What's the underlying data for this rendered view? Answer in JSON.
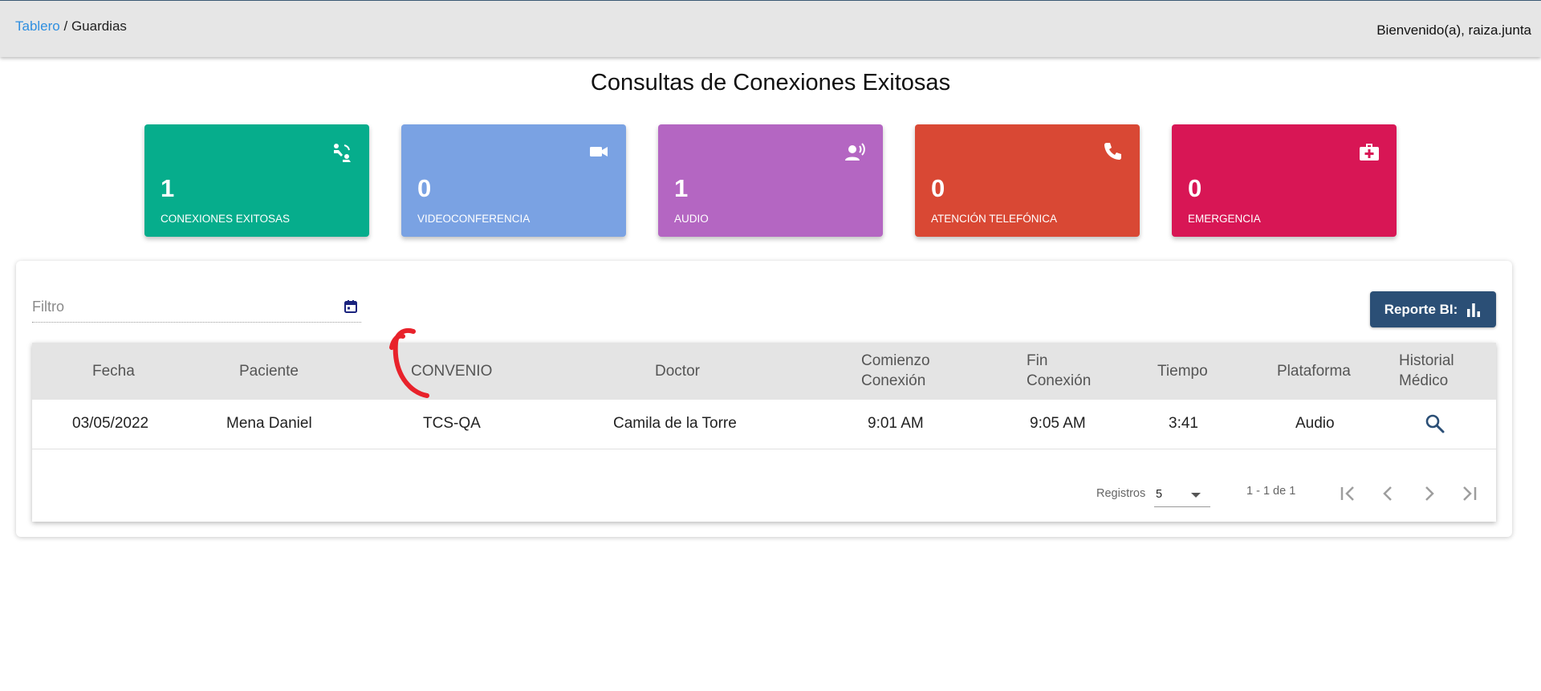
{
  "header": {
    "breadcrumb_link": "Tablero",
    "breadcrumb_sep": " / ",
    "breadcrumb_current": "Guardias",
    "welcome": "Bienvenido(a), raiza.junta"
  },
  "page_title": "Consultas de Conexiones Exitosas",
  "cards": [
    {
      "count": "1",
      "label": "CONEXIONES EXITOSAS",
      "color": "#06ad8c",
      "icon": "connection-icon"
    },
    {
      "count": "0",
      "label": "VIDEOCONFERENCIA",
      "color": "#7aa2e3",
      "icon": "videocam-icon"
    },
    {
      "count": "1",
      "label": "AUDIO",
      "color": "#b466c2",
      "icon": "record-voice-icon"
    },
    {
      "count": "0",
      "label": "ATENCIÓN TELEFÓNICA",
      "color": "#d94834",
      "icon": "phone-icon"
    },
    {
      "count": "0",
      "label": "EMERGENCIA",
      "color": "#d81655",
      "icon": "medical-kit-icon"
    }
  ],
  "filter": {
    "placeholder": "Filtro"
  },
  "report_button": {
    "label": "Reporte BI:"
  },
  "table": {
    "headers": [
      "Fecha",
      "Paciente",
      "CONVENIO",
      "Doctor",
      "Comienzo\nConexión",
      "Fin\nConexión",
      "Tiempo",
      "Plataforma",
      "Historial\nMédico"
    ],
    "headers_split": {
      "comienzo_1": "Comienzo",
      "comienzo_2": "Conexión",
      "fin_1": "Fin",
      "fin_2": "Conexión",
      "historial_1": "Historial",
      "historial_2": "Médico"
    },
    "rows": [
      {
        "fecha": "03/05/2022",
        "paciente": "Mena Daniel",
        "convenio": "TCS-QA",
        "doctor": "Camila de la Torre",
        "comienzo": "9:01 AM",
        "fin": "9:05 AM",
        "tiempo": "3:41",
        "plataforma": "Audio"
      }
    ]
  },
  "paginator": {
    "label": "Registros",
    "page_size": "5",
    "range": "1 - 1 de 1"
  },
  "colors": {
    "topbar": "#e6e6e6",
    "link": "#2f8fe0",
    "report_button": "#2b4f76",
    "annotation": "#e8222b"
  }
}
